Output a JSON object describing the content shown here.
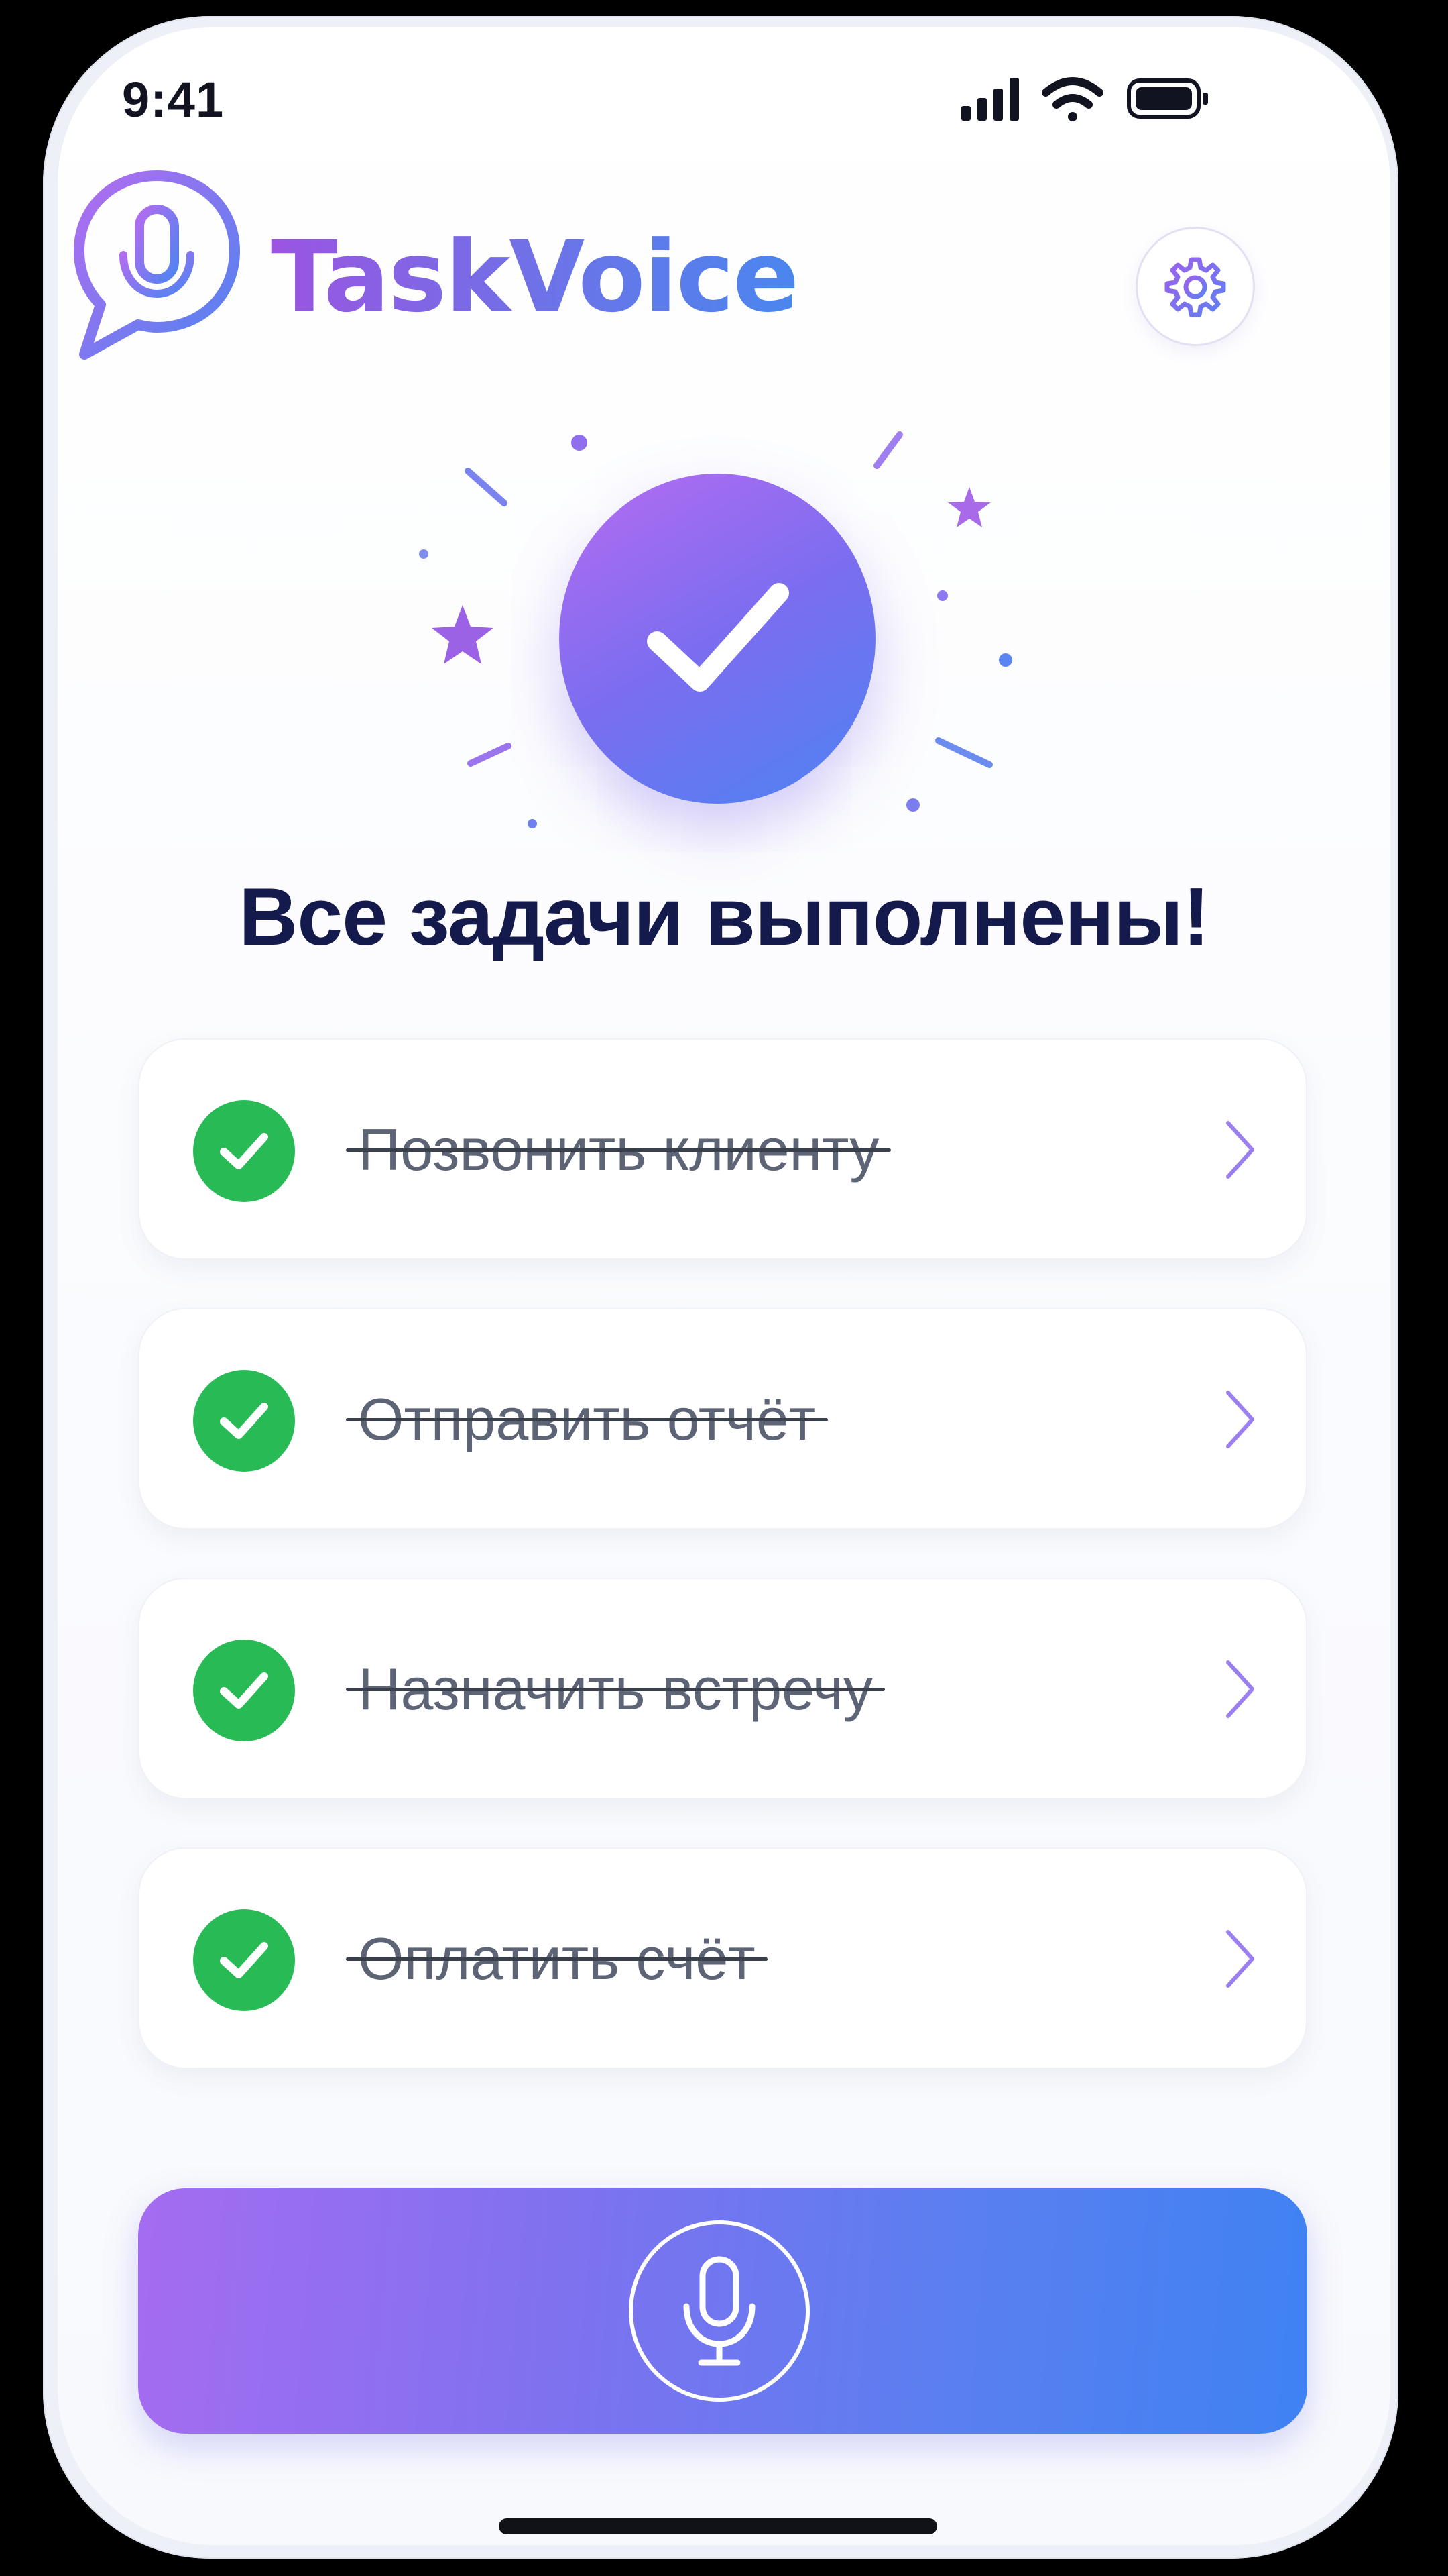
{
  "status_bar": {
    "time": "9:41",
    "icons": [
      "cellular-signal-icon",
      "wifi-icon",
      "battery-icon"
    ]
  },
  "header": {
    "app_name": "TaskVoice",
    "logo_icon": "microphone-speech-bubble-icon",
    "settings_icon": "gear-icon"
  },
  "celebration": {
    "icon": "checkmark-icon",
    "headline": "Все задачи выполнены!"
  },
  "tasks": [
    {
      "title": "Позвонить клиенту",
      "completed": true
    },
    {
      "title": "Отправить отчёт",
      "completed": true
    },
    {
      "title": "Назначить встречу",
      "completed": true
    },
    {
      "title": "Оплатить счёт",
      "completed": true
    }
  ],
  "voice_input": {
    "icon": "microphone-icon"
  },
  "colors": {
    "accent_purple": "#a56cf0",
    "accent_blue": "#3f82f3",
    "success_green": "#27ba55",
    "headline_navy": "#151a4c"
  }
}
